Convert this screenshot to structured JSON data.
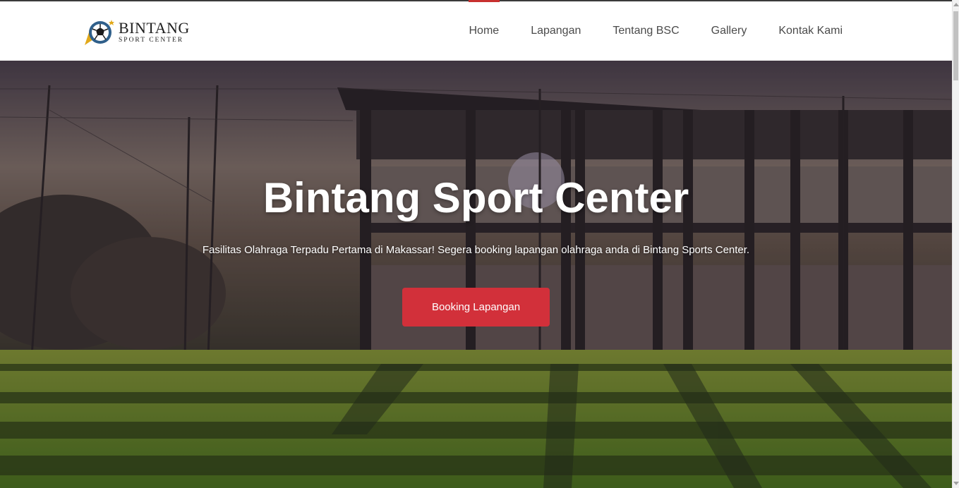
{
  "brand": {
    "title": "BINTANG",
    "subtitle": "SPORT CENTER",
    "logo_icon": "soccer-ball-star-icon"
  },
  "nav": {
    "items": [
      {
        "label": "Home",
        "active": true
      },
      {
        "label": "Lapangan",
        "active": false
      },
      {
        "label": "Tentang BSC",
        "active": false
      },
      {
        "label": "Gallery",
        "active": false
      },
      {
        "label": "Kontak Kami",
        "active": false
      }
    ]
  },
  "hero": {
    "title": "Bintang Sport Center",
    "subtitle": "Fasilitas Olahraga Terpadu Pertama di Makassar! Segera booking lapangan olahraga anda di Bintang Sports Center.",
    "cta_label": "Booking Lapangan"
  },
  "colors": {
    "accent": "#d2303a",
    "nav_active": "#c8302f",
    "nav_text": "#4b4b4b"
  }
}
